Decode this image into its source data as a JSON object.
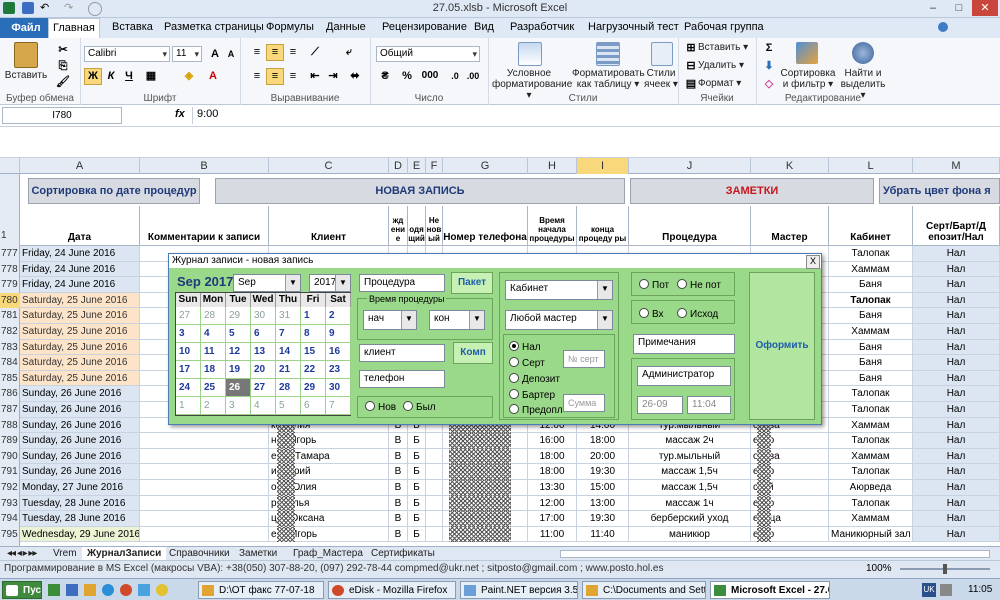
{
  "window": {
    "title": "27.05.xlsb - Microsoft Excel"
  },
  "ribbon_tabs": [
    "Файл",
    "Главная",
    "Вставка",
    "Разметка страницы",
    "Формулы",
    "Данные",
    "Рецензирование",
    "Вид",
    "Разработчик",
    "Нагрузочный тест",
    "Рабочая группа"
  ],
  "ribbon": {
    "paste_label": "Вставить",
    "clipboard_group": "Буфер обмена",
    "font_name": "Calibri",
    "font_size": "11",
    "font_group": "Шрифт",
    "bold": "Ж",
    "italic": "К",
    "underline": "Ч",
    "align_group": "Выравнивание",
    "number_format": "Общий",
    "number_group": "Число",
    "percent": "%",
    "thousands": "000",
    "cond_format": "Условное форматирование ▾",
    "format_table": "Форматировать как таблицу ▾",
    "cell_styles": "Стили ячеек ▾",
    "styles_group": "Стили",
    "insert_cells": "Вставить ▾",
    "delete_cells": "Удалить ▾",
    "format_cells": "Формат ▾",
    "cells_group": "Ячейки",
    "sort_filter": "Сортировка и фильтр ▾",
    "find_select": "Найти и выделить ▾",
    "editing_group": "Редактирование"
  },
  "formula_bar": {
    "name_box": "I780",
    "fx": "fx",
    "formula": "9:00"
  },
  "columns": [
    "A",
    "B",
    "C",
    "D",
    "E",
    "F",
    "G",
    "H",
    "I",
    "J",
    "K",
    "L",
    "M"
  ],
  "top_buttons": {
    "sort": "Сортировка по дате процедур",
    "new_record": "НОВАЯ ЗАПИСЬ",
    "notes": "ЗАМЕТКИ",
    "remove_color": "Убрать цвет фона я"
  },
  "headers": {
    "row": "1",
    "date": "Дата",
    "comments": "Комментарии к записи",
    "client": "Клиент",
    "d": "жд ени е",
    "e": "одя щий",
    "f": "Не нов ый",
    "phone": "Номер телефона",
    "start": "Время начала процедуры",
    "end": "конца процеду ры",
    "procedure": "Процедура",
    "master": "Мастер",
    "room": "Кабинет",
    "cert": "Серт/Барт/Д епозит/Нал"
  },
  "rows": [
    {
      "n": "777",
      "date": "Friday, 24 June 2016",
      "client": "",
      "d": "",
      "e": "",
      "f": "",
      "start": "",
      "end": "",
      "proc": "",
      "master": "",
      "room": "Талопак",
      "pay": "Нал"
    },
    {
      "n": "778",
      "date": "Friday, 24 June 2016",
      "client": "",
      "d": "",
      "e": "",
      "f": "",
      "start": "",
      "end": "",
      "proc": "",
      "master": "",
      "room": "Хаммам",
      "pay": "Нал"
    },
    {
      "n": "779",
      "date": "Friday, 24 June 2016",
      "client": "",
      "d": "",
      "e": "",
      "f": "",
      "start": "",
      "end": "",
      "proc": "",
      "master": "",
      "room": "Баня",
      "pay": "Нал"
    },
    {
      "n": "780",
      "date": "Saturday, 25 June 2016",
      "client": "",
      "d": "",
      "e": "",
      "f": "",
      "start": "",
      "end": "",
      "proc": "",
      "master": "",
      "room": "Талопак",
      "pay": "Нал"
    },
    {
      "n": "781",
      "date": "Saturday, 25 June 2016",
      "client": "",
      "d": "",
      "e": "",
      "f": "",
      "start": "",
      "end": "",
      "proc": "",
      "master": "",
      "room": "Баня",
      "pay": "Нал"
    },
    {
      "n": "782",
      "date": "Saturday, 25 June 2016",
      "client": "",
      "d": "",
      "e": "",
      "f": "",
      "start": "",
      "end": "",
      "proc": "",
      "master": "",
      "room": "Хаммам",
      "pay": "Нал"
    },
    {
      "n": "783",
      "date": "Saturday, 25 June 2016",
      "client": "",
      "d": "",
      "e": "",
      "f": "",
      "start": "",
      "end": "",
      "proc": "",
      "master": "",
      "room": "Баня",
      "pay": "Нал"
    },
    {
      "n": "784",
      "date": "Saturday, 25 June 2016",
      "client": "",
      "d": "",
      "e": "",
      "f": "",
      "start": "",
      "end": "",
      "proc": "",
      "master": "",
      "room": "Баня",
      "pay": "Нал"
    },
    {
      "n": "785",
      "date": "Saturday, 25 June 2016",
      "client": "",
      "d": "",
      "e": "",
      "f": "",
      "start": "",
      "end": "",
      "proc": "",
      "master": "",
      "room": "Баня",
      "pay": "Нал"
    },
    {
      "n": "786",
      "date": "Sunday, 26 June 2016",
      "client": "",
      "d": "",
      "e": "",
      "f": "",
      "start": "",
      "end": "",
      "proc": "",
      "master": "",
      "room": "Талопак",
      "pay": "Нал"
    },
    {
      "n": "787",
      "date": "Sunday, 26 June 2016",
      "client": "",
      "d": "",
      "e": "",
      "f": "",
      "start": "",
      "end": "",
      "proc": "",
      "master": "",
      "room": "Талопак",
      "pay": "Нал"
    },
    {
      "n": "788",
      "date": "Sunday, 26 June 2016",
      "client": "ко Юлия",
      "d": "В",
      "e": "Б",
      "f": "",
      "start": "12:00",
      "end": "14:00",
      "proc": "тур.мыльный",
      "master": "охова",
      "room": "Хаммам",
      "pay": "Нал"
    },
    {
      "n": "789",
      "date": "Sunday, 26 June 2016",
      "client": "нко Игорь",
      "d": "В",
      "e": "Б",
      "f": "",
      "start": "16:00",
      "end": "18:00",
      "proc": "массаж 2ч",
      "master": "енко",
      "room": "Талопак",
      "pay": "Нал"
    },
    {
      "n": "790",
      "date": "Sunday, 26 June 2016",
      "client": "енко Тамара",
      "d": "В",
      "e": "Б",
      "f": "",
      "start": "18:00",
      "end": "20:00",
      "proc": "тур.мыльный",
      "master": "охова",
      "room": "Хаммам",
      "pay": "Нал"
    },
    {
      "n": "791",
      "date": "Sunday, 26 June 2016",
      "client": "ик Юрий",
      "d": "В",
      "e": "Б",
      "f": "",
      "start": "18:00",
      "end": "19:30",
      "proc": "массаж 1,5ч",
      "master": "енко",
      "room": "Талопак",
      "pay": "Нал"
    },
    {
      "n": "792",
      "date": "Monday, 27 June 2016",
      "client": "ова Юлия",
      "d": "В",
      "e": "Б",
      "f": "",
      "start": "13:30",
      "end": "15:00",
      "proc": "массаж 1,5ч",
      "master": "ской",
      "room": "Аюрведа",
      "pay": "Нал"
    },
    {
      "n": "793",
      "date": "Tuesday, 28 June 2016",
      "client": "риполья",
      "d": "В",
      "e": "Б",
      "f": "",
      "start": "12:00",
      "end": "13:00",
      "proc": "массаж 1ч",
      "master": "енко",
      "room": "Талопак",
      "pay": "Нал"
    },
    {
      "n": "794",
      "date": "Tuesday, 28 June 2016",
      "client": "цей Оксана",
      "d": "В",
      "e": "Б",
      "f": "",
      "start": "17:00",
      "end": "19:30",
      "proc": "берберский уход",
      "master": "елица",
      "room": "Хаммам",
      "pay": "Нал"
    },
    {
      "n": "795",
      "date": "Wednesday, 29 June 2016",
      "client": "ева Игорь",
      "d": "В",
      "e": "Б",
      "f": "",
      "start": "11:00",
      "end": "11:40",
      "proc": "маникюр",
      "master": "енко",
      "room": "Маникюрный зал",
      "pay": "Нал"
    }
  ],
  "dialog": {
    "title": "Журнал записи - новая запись",
    "close": "X",
    "cal_title": "Sep 2017",
    "month": "Sep",
    "year": "2017",
    "weekdays": [
      "Sun",
      "Mon",
      "Tue",
      "Wed",
      "Thu",
      "Fri",
      "Sat"
    ],
    "days": [
      [
        "27",
        "28",
        "29",
        "30",
        "31",
        "1",
        "2"
      ],
      [
        "3",
        "4",
        "5",
        "6",
        "7",
        "8",
        "9"
      ],
      [
        "10",
        "11",
        "12",
        "13",
        "14",
        "15",
        "16"
      ],
      [
        "17",
        "18",
        "19",
        "20",
        "21",
        "22",
        "23"
      ],
      [
        "24",
        "25",
        "26",
        "27",
        "28",
        "29",
        "30"
      ],
      [
        "1",
        "2",
        "3",
        "4",
        "5",
        "6",
        "7"
      ]
    ],
    "procedure": "Процедура",
    "package": "Пакет",
    "time_group": "Время процедуры",
    "start": "нач",
    "end": "кон",
    "client": "клиент",
    "comp": "Комп",
    "phone": "телефон",
    "new": "Нов",
    "was": "Был",
    "room": "Кабинет",
    "master": "Любой мастер",
    "pay_cash": "Нал",
    "pay_cert": "Серт",
    "cert_no": "№ серт",
    "pay_deposit": "Депозит",
    "pay_barter": "Бартер",
    "pay_prepay": "Предопл",
    "sum": "Сумма",
    "sweat": "Пот",
    "no_sweat": "Не пот",
    "in": "Вх",
    "out": "Исход",
    "notes": "Примечания",
    "submit": "Оформить",
    "admin": "Администратор",
    "date_val": "26-09",
    "time_val": "11:04"
  },
  "sheet_tabs": [
    "Vrem",
    "ЖурналЗаписи",
    "Справочники",
    "Заметки",
    "Граф_Мастера",
    "Сертификаты"
  ],
  "status": {
    "text": "Программирование в MS Excel (макросы VBA): +38(050) 307-88-20, (097) 292-78-44 compmed@ukr.net ; sitposto@gmail.com ; www.posto.hol.es",
    "zoom": "100%"
  },
  "taskbar": {
    "start": "Пуск",
    "tasks": [
      "D:\\ОТ факс 77-07-18",
      "eDisk - Mozilla Firefox",
      "Paint.NET версия 3.5.11",
      "C:\\Documents and Settin...",
      "Microsoft Excel - 27.0..."
    ],
    "lang": "UK",
    "clock": "11:05"
  },
  "colors": {
    "accent": "#2a6db8",
    "dialog_bg": "#9ad88a",
    "selected": "#f8d87a",
    "row_blue": "#dce6f2",
    "row_orange": "#fde4c8",
    "row_green": "#eaf3d3"
  }
}
